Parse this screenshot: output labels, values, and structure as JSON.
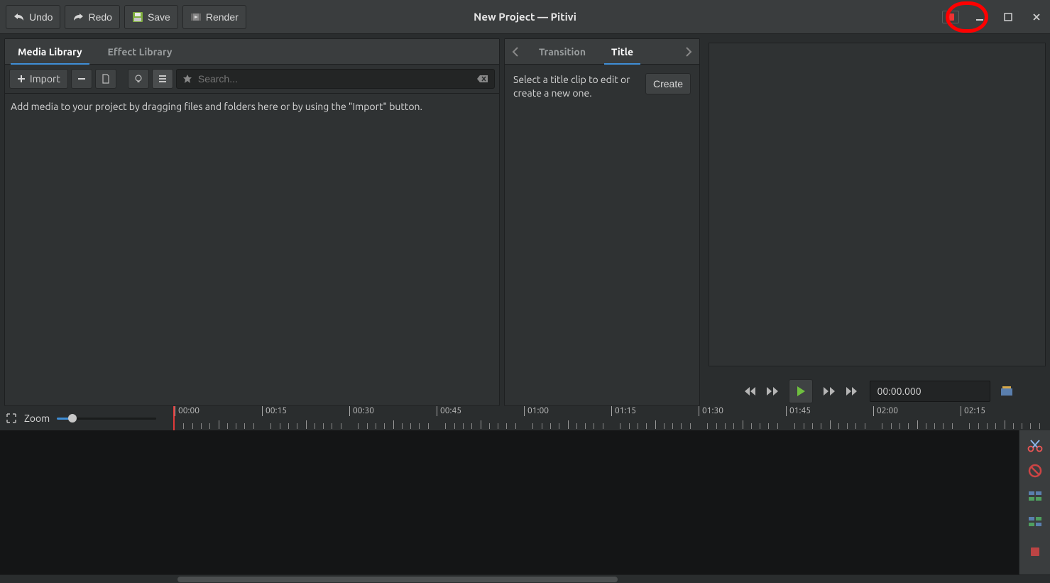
{
  "titlebar": {
    "title": "New Project — Pitivi",
    "undo": "Undo",
    "redo": "Redo",
    "save": "Save",
    "render": "Render"
  },
  "left_panel": {
    "tabs": {
      "media": "Media Library",
      "effects": "Effect Library"
    },
    "import_label": "Import",
    "search_placeholder": "Search...",
    "empty_hint": "Add media to your project by dragging files and folders here or by using the \"Import\" button."
  },
  "mid_panel": {
    "tabs": {
      "transition": "Transition",
      "title": "Title"
    },
    "hint": "Select a title clip to edit or create a new one.",
    "create_label": "Create"
  },
  "playback": {
    "timecode": "00:00.000"
  },
  "timeline": {
    "zoom_label": "Zoom",
    "marks": [
      "00:00",
      "00:15",
      "00:30",
      "00:45",
      "01:00",
      "01:15",
      "01:30",
      "01:45",
      "02:00",
      "02:15"
    ]
  }
}
